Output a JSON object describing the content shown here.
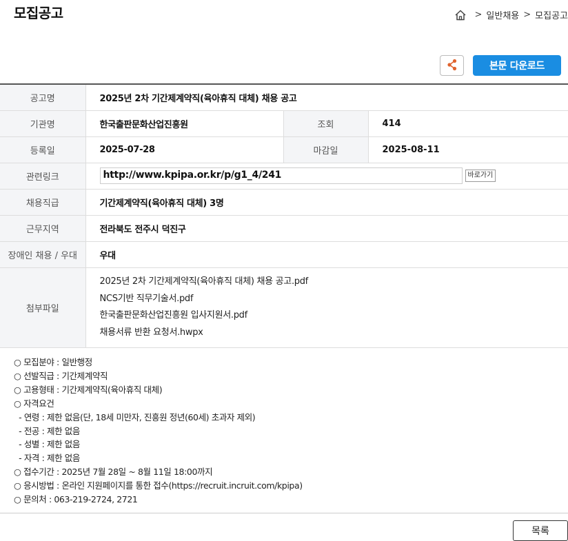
{
  "page_title": "모집공고",
  "breadcrumb": {
    "home_icon": "home-icon",
    "sep": ">",
    "item1": "일반채용",
    "item2": "모집공고"
  },
  "toolbar": {
    "share_icon": "share-icon",
    "download_label": "본문 다운로드"
  },
  "table": {
    "title_label": "공고명",
    "title_value": "2025년 2차 기간제계약직(육아휴직 대체) 채용 공고",
    "org_label": "기관명",
    "org_value": "한국출판문화산업진흥원",
    "views_label": "조회",
    "views_value": "414",
    "reg_label": "등록일",
    "reg_value": "2025-07-28",
    "deadline_label": "마감일",
    "deadline_value": "2025-08-11",
    "link_label": "관련링크",
    "link_value": "http://www.kpipa.or.kr/p/g1_4/241",
    "link_button": "바로가기",
    "rank_label": "채용직급",
    "rank_value": "기간제계약직(육아휴직 대체) 3명",
    "region_label": "근무지역",
    "region_value": "전라북도 전주시 덕진구",
    "disabled_label": "장애인 채용 / 우대",
    "disabled_value": "우대",
    "files_label": "첨부파일",
    "files": [
      "2025년 2차 기간제계약직(육아휴직 대체) 채용 공고.pdf",
      "NCS기반 직무기술서.pdf",
      "한국출판문화산업진흥원 입사지원서.pdf",
      "채용서류 반환 요청서.hwpx"
    ]
  },
  "details": [
    "○ 모집분야 : 일반행정",
    "○ 선발직급 : 기간제계약직",
    "○ 고용형태 : 기간제계약직(육아휴직 대체)",
    "○ 자격요건",
    "  - 연령 : 제한 없음(단, 18세 미만자, 진흥원 정년(60세) 초과자 제외)",
    "  - 전공 : 제한 없음",
    "  - 성별 : 제한 없음",
    "  - 자격 : 제한 없음",
    "○ 접수기간 : 2025년 7월 28일 ~ 8월 11일 18:00까지",
    "○ 응시방법 : 온라인 지원페이지를 통한 접수(https://recruit.incruit.com/kpipa)",
    "○ 문의처 : 063-219-2724, 2721"
  ],
  "footer": {
    "list_button": "목록"
  },
  "colors": {
    "accent": "#1a8de2",
    "share": "#e0632e"
  }
}
